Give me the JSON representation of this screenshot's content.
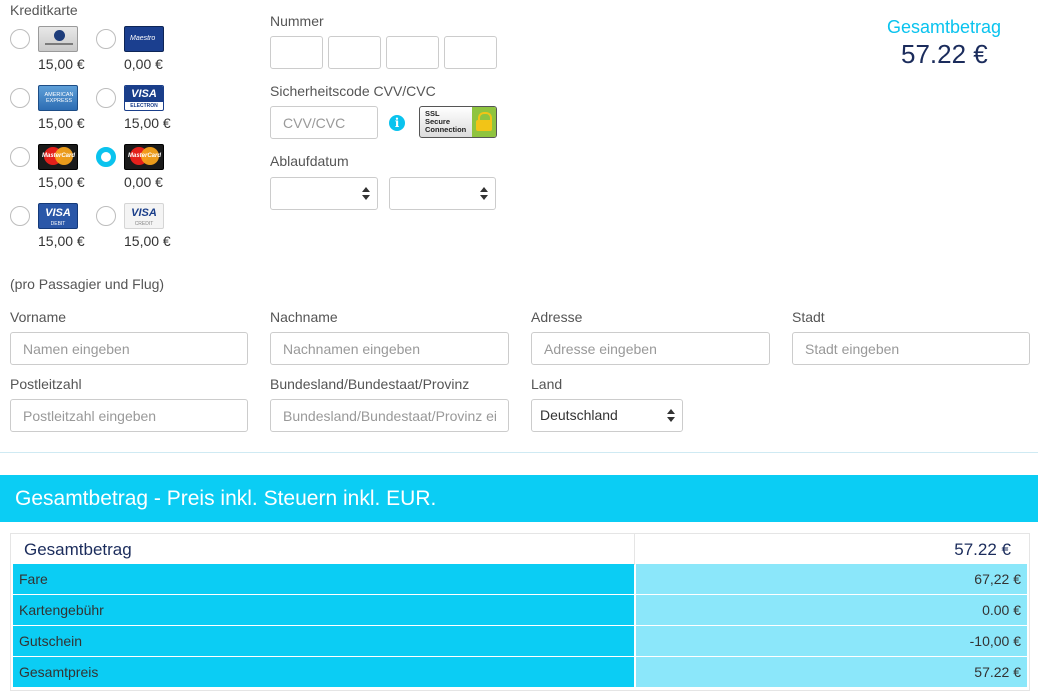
{
  "payment": {
    "card_label": "Kreditkarte",
    "cards": [
      {
        "name": "Diners Club",
        "price": "15,00 €",
        "checked": false,
        "icon": "diners-club-logo-icon"
      },
      {
        "name": "Maestro",
        "price": "0,00 €",
        "checked": false,
        "icon": "maestro-logo-icon"
      },
      {
        "name": "American Express",
        "price": "15,00 €",
        "checked": false,
        "icon": "american-express-logo-icon"
      },
      {
        "name": "Visa Electron",
        "price": "15,00 €",
        "checked": false,
        "icon": "visa-electron-logo-icon"
      },
      {
        "name": "MasterCard Credit",
        "price": "15,00 €",
        "checked": false,
        "icon": "mastercard-credit-logo-icon"
      },
      {
        "name": "MasterCard Debit",
        "price": "0,00 €",
        "checked": true,
        "icon": "mastercard-debit-logo-icon"
      },
      {
        "name": "Visa Debit",
        "price": "15,00 €",
        "checked": false,
        "icon": "visa-debit-logo-icon"
      },
      {
        "name": "Visa Credit",
        "price": "15,00 €",
        "checked": false,
        "icon": "visa-credit-logo-icon"
      }
    ],
    "number_label": "Nummer",
    "cvv_label": "Sicherheitscode CVV/CVC",
    "cvv_placeholder": "CVV/CVC",
    "ssl_text": "SSL Secure Connection",
    "expiry_label": "Ablaufdatum",
    "expiry_month": "",
    "expiry_year": ""
  },
  "total_box": {
    "label": "Gesamtbetrag",
    "value": "57.22 €"
  },
  "address": {
    "note": "(pro Passagier und Flug)",
    "firstname_label": "Vorname",
    "firstname_placeholder": "Namen eingeben",
    "lastname_label": "Nachname",
    "lastname_placeholder": "Nachnamen eingeben",
    "street_label": "Adresse",
    "street_placeholder": "Adresse eingeben",
    "city_label": "Stadt",
    "city_placeholder": "Stadt eingeben",
    "zip_label": "Postleitzahl",
    "zip_placeholder": "Postleitzahl eingeben",
    "state_label": "Bundesland/Bundestaat/Provinz",
    "state_placeholder": "Bundesland/Bundestaat/Provinz eingeben",
    "country_label": "Land",
    "country_value": "Deutschland"
  },
  "summary": {
    "banner": "Gesamtbetrag - Preis inkl. Steuern inkl. EUR.",
    "head_label": "Gesamtbetrag",
    "head_value": "57.22 €",
    "rows": [
      {
        "label": "Fare",
        "value": "67,22 €"
      },
      {
        "label": "Kartengebühr",
        "value": "0.00 €"
      },
      {
        "label": "Gutschein",
        "value": "-10,00 €"
      },
      {
        "label": "Gesamtpreis",
        "value": "57.22 €"
      }
    ]
  },
  "colors": {
    "accent": "#0bcdf4",
    "accent_light": "#8be7fa",
    "dark_blue": "#1b2c5c"
  }
}
